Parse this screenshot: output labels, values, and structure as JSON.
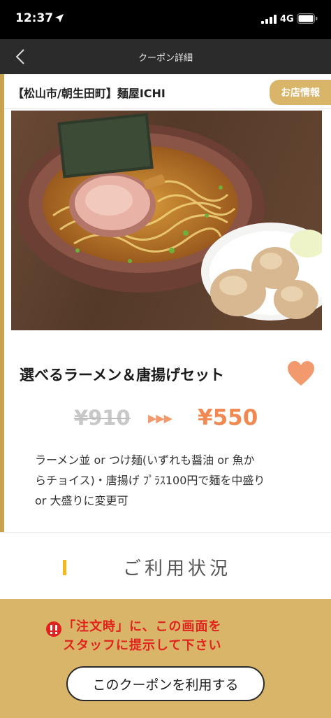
{
  "status_bar": {
    "time": "12:37",
    "network": "4G",
    "icons": [
      "location-arrow-icon",
      "signal-bars-icon",
      "battery-icon"
    ]
  },
  "nav": {
    "title": "クーポン詳細",
    "back_icon": "chevron-left-icon"
  },
  "shop": {
    "name": "【松山市/朝生田町】麺屋ICHI",
    "info_button_label": "お店情報"
  },
  "coupon": {
    "title": "選べるラーメン＆唐揚げセット",
    "favorite_icon": "heart-icon",
    "old_price": "¥910",
    "new_price": "¥550",
    "description_lines": [
      "ラーメン並 or つけ麺(いずれも醤油 or 魚か",
      "らチョイス)・唐揚げ ﾌﾟﾗｽ100円で麺を中盛り",
      "or 大盛りに変更可"
    ]
  },
  "usage": {
    "title": "ご利用状況"
  },
  "footer": {
    "notice_icon": "exclamation-circle-icon",
    "notice_lines": [
      "「注文時」に、この画面を",
      "スタッフに提示して下さい"
    ],
    "button_label": "このクーポンを利用する"
  },
  "colors": {
    "accent_gold": "#d9b56a",
    "price_orange": "#f08a52",
    "notice_red": "#e0231c",
    "heart": "#f29a6e"
  }
}
